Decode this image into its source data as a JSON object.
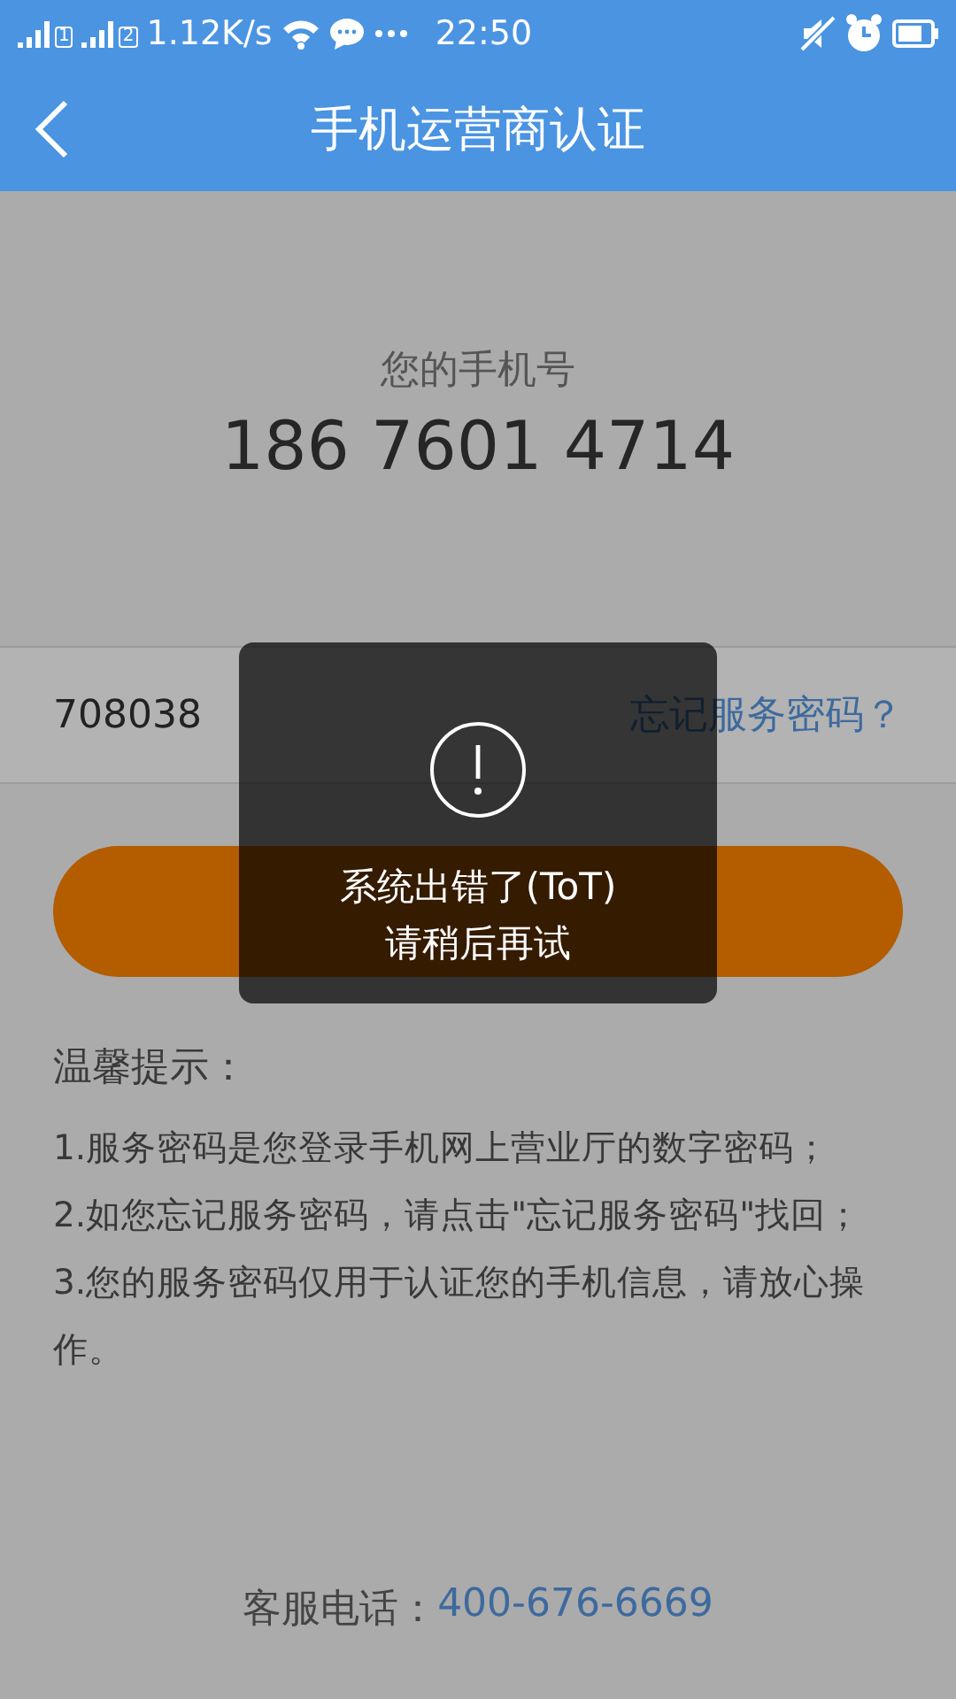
{
  "status_bar": {
    "sim_labels": [
      "1",
      "2"
    ],
    "speed": "1.12K/s",
    "time": "22:50"
  },
  "header": {
    "title": "手机运营商认证"
  },
  "phone": {
    "label": "您的手机号",
    "number": "186 7601 4714"
  },
  "password": {
    "value": "708038",
    "forgot_link": "忘记服务密码？"
  },
  "tips": {
    "title": "温馨提示：",
    "items": [
      "1.服务密码是您登录手机网上营业厅的数字密码；",
      "2.如您忘记服务密码，请点击\"忘记服务密码\"找回；",
      "3.您的服务密码仅用于认证您的手机信息，请放心操作。"
    ]
  },
  "hotline": {
    "label": "客服电话：",
    "number": "400-676-6669"
  },
  "toast": {
    "lines": [
      "系统出错了(ToT)",
      "请稍后再试"
    ]
  }
}
